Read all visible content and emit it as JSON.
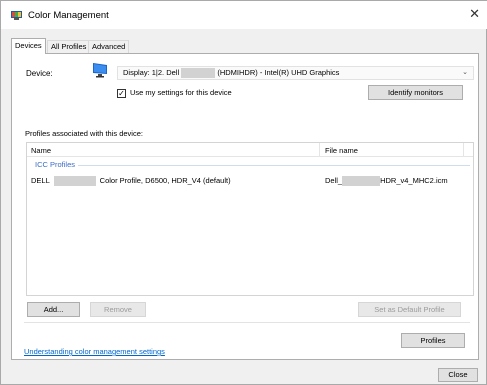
{
  "window": {
    "title": "Color Management",
    "close_glyph": "✕"
  },
  "tabs": [
    {
      "label": "Devices",
      "active": true
    },
    {
      "label": "All Profiles",
      "active": false
    },
    {
      "label": "Advanced",
      "active": false
    }
  ],
  "device": {
    "label": "Device:",
    "select_prefix": "Display: 1|2. Dell",
    "select_suffix": "(HDMIHDR) - Intel(R) UHD Graphics",
    "use_settings_label": "Use my settings for this device",
    "use_settings_checked": true,
    "identify_button": "Identify monitors"
  },
  "profiles": {
    "section_label": "Profiles associated with this device:",
    "columns": {
      "name": "Name",
      "file": "File name"
    },
    "group_label": "ICC Profiles",
    "rows": [
      {
        "name_prefix": "DELL",
        "name_suffix": "Color Profile, D6500, HDR_V4 (default)",
        "file_prefix": "Dell_",
        "file_suffix": "HDR_v4_MHC2.icm"
      }
    ]
  },
  "actions": {
    "add": "Add...",
    "remove": "Remove",
    "set_default": "Set as Default Profile",
    "profiles": "Profiles"
  },
  "footer": {
    "link": "Understanding color management settings",
    "close": "Close"
  },
  "icons": {
    "app": "color-management-icon",
    "monitor": "monitor-icon",
    "close": "close-icon",
    "chevron": "chevron-down-icon",
    "check": "checkmark-icon"
  },
  "colors": {
    "link": "#0066cc",
    "group": "#3b6cc5"
  }
}
